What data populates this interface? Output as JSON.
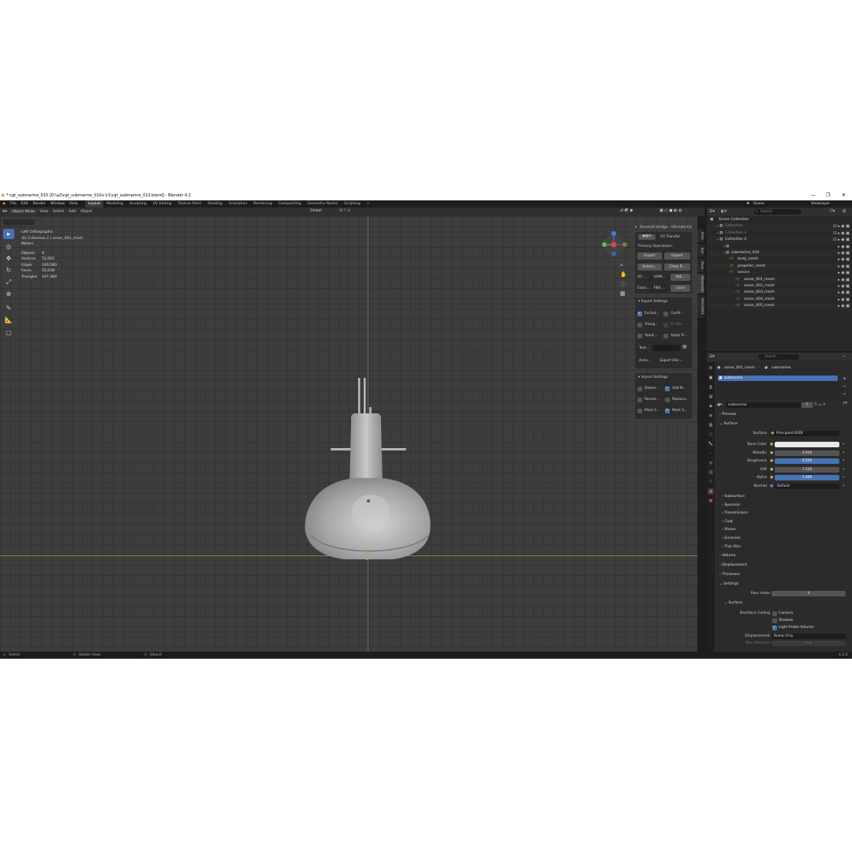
{
  "window": {
    "title": "* cgt_submarine_010 [D:\\a2\\cgt_submarine_010+\\r1\\cgt_submarine_010.blend] - Blender 4.2",
    "minimize": "—",
    "maximize": "❐",
    "close": "✕"
  },
  "menu": [
    "File",
    "Edit",
    "Render",
    "Window",
    "Help"
  ],
  "workspaces": [
    "Layout",
    "Modeling",
    "Sculpting",
    "UV Editing",
    "Texture Paint",
    "Shading",
    "Animation",
    "Rendering",
    "Compositing",
    "Geometry Nodes",
    "Scripting",
    "+"
  ],
  "active_workspace": "Layout",
  "scene": {
    "label": "Scene",
    "view_layer": "ViewLayer"
  },
  "header": {
    "mode": "Object Mode",
    "menus": [
      "View",
      "Select",
      "Add",
      "Object"
    ],
    "transform_orientation": "Global",
    "options": "Options"
  },
  "viewport": {
    "view_name": "Left Orthographic",
    "collection_info": "(0) Collection 2 | sonar_001_mesh",
    "units": "Meters",
    "stats": [
      {
        "label": "Objects",
        "value": "9"
      },
      {
        "label": "Vertices",
        "value": "53,950"
      },
      {
        "label": "Edges",
        "value": "109,580"
      },
      {
        "label": "Faces",
        "value": "55,638"
      },
      {
        "label": "Triangles",
        "value": "107,484"
      }
    ],
    "gizmo": {
      "y": "Y",
      "z": "Z"
    }
  },
  "npanel": {
    "title": "RizomUV Bridge - Ultimate Ed",
    "uv_transfer": "UV Transfer",
    "primary_ops": "Primary Operations:",
    "export": "Export",
    "import": "Import",
    "automatic": "Autom...",
    "close": "Close R...",
    "uv_label": "UV ...",
    "uv_map": "UVM...",
    "validate": "Vali...",
    "export_fmt_label": "Expo...",
    "fbx": "FBX ...",
    "load": "Load",
    "export_settings": "Export Settings",
    "exclude": "Exclud...",
    "confirm": "Confir...",
    "triangulate": "Triang...",
    "fix_normals": "Fix Na...",
    "apply_mod": "Apply ...",
    "apply_r": "Apply R...",
    "text_label": "Text...",
    "action_label": "Actio...",
    "export_uvs": "Export UVs",
    "import_settings": "Import Settings",
    "delete": "Delete ...",
    "add_m": "Add M...",
    "reveal": "Reveal ...",
    "replace": "Replace...",
    "mark_s1": "Mark S...",
    "mark_s2": "Mark S..."
  },
  "side_tabs": [
    "Item",
    "Tool",
    "View",
    "RizomUV",
    "MACHIN3"
  ],
  "outliner": {
    "search_placeholder": "Search",
    "rows": [
      {
        "name": "Scene Collection",
        "indent": 0,
        "dim": false
      },
      {
        "name": "Collection",
        "indent": 1,
        "dim": true
      },
      {
        "name": "Collection 3",
        "indent": 1,
        "dim": true
      },
      {
        "name": "Collection 2",
        "indent": 1,
        "dim": false
      },
      {
        "name": "",
        "indent": 2,
        "dim": true
      },
      {
        "name": "submarine_010",
        "indent": 2,
        "dim": false
      },
      {
        "name": "body_mesh",
        "indent": 3,
        "dim": false
      },
      {
        "name": "propeller_mesh",
        "indent": 3,
        "dim": false
      },
      {
        "name": "sonars",
        "indent": 3,
        "dim": false
      },
      {
        "name": "sonar_001_mesh",
        "indent": 4,
        "dim": false
      },
      {
        "name": "sonar_002_mesh",
        "indent": 4,
        "dim": false
      },
      {
        "name": "sonar_003_mesh",
        "indent": 4,
        "dim": false
      },
      {
        "name": "sonar_004_mesh",
        "indent": 4,
        "dim": false
      },
      {
        "name": "sonar_005_mesh",
        "indent": 4,
        "dim": false
      }
    ]
  },
  "properties": {
    "search_placeholder": "Search",
    "breadcrumb_obj": "sonar_001_mesh",
    "breadcrumb_mat": "submarine",
    "slot": "submarine",
    "material_name": "submarine",
    "user_count": "7",
    "preview": "Preview",
    "surface_section": "Surface",
    "surface_label": "Surface",
    "surface_value": "Principled BSDF",
    "fields": [
      {
        "label": "Base Color",
        "value": "",
        "kind": "color"
      },
      {
        "label": "Metallic",
        "value": "0.000",
        "kind": "plain"
      },
      {
        "label": "Roughness",
        "value": "0.500",
        "kind": "blue"
      },
      {
        "label": "IOR",
        "value": "1.500",
        "kind": "plain"
      },
      {
        "label": "Alpha",
        "value": "1.000",
        "kind": "blue"
      },
      {
        "label": "Normal",
        "value": "Default",
        "kind": "dark"
      }
    ],
    "subsections": [
      "Subsurface",
      "Specular",
      "Transmission",
      "Coat",
      "Sheen",
      "Emission",
      "Thin Film"
    ],
    "volume": "Volume",
    "displacement": "Displacement",
    "thickness": "Thickness",
    "settings": "Settings",
    "pass_index_label": "Pass Index",
    "pass_index": "0",
    "settings_surface": "Surface",
    "backface_culling": "Backface Culling",
    "camera": "Camera",
    "shadow": "Shadow",
    "light_probe": "Light Probe Volume",
    "displacement_label": "Displacement",
    "displacement_value": "Bump Only",
    "max_distance_label": "Max Distance",
    "max_distance": "0 m"
  },
  "status": {
    "select": "Select",
    "rotate": "Rotate View",
    "object": "Object",
    "version": "4.2.0"
  },
  "colors": {
    "accent": "#4772b3",
    "active_orange": "#e8953a",
    "bg": "#3d3d3d"
  }
}
